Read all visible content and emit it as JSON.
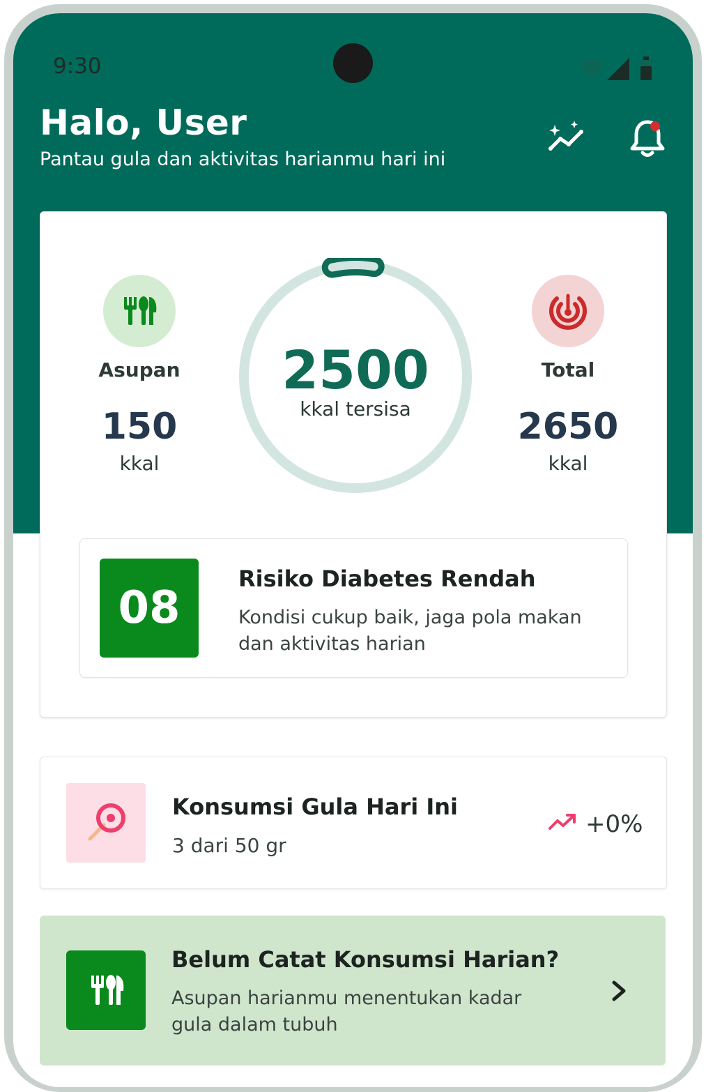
{
  "status_bar": {
    "time": "9:30"
  },
  "header": {
    "greeting": "Halo, User",
    "subtitle": "Pantau gula dan aktivitas harianmu hari ini",
    "icons": [
      "insights-icon",
      "notification-bell-icon"
    ]
  },
  "calorie_summary": {
    "intake": {
      "label": "Asupan",
      "value": "150",
      "unit": "kkal",
      "icon": "utensils-icon"
    },
    "remaining": {
      "value": "2500",
      "caption": "kkal tersisa",
      "progress_fraction": 0.06
    },
    "total": {
      "label": "Total",
      "value": "2650",
      "unit": "kkal",
      "icon": "target-icon"
    }
  },
  "risk": {
    "score": "08",
    "title": "Risiko Diabetes Rendah",
    "description": "Kondisi cukup baik, jaga pola makan dan aktivitas harian"
  },
  "sugar": {
    "title": "Konsumsi Gula Hari Ini",
    "subtitle": "3 dari 50 gr",
    "trend": "+0%",
    "icon": "lollipop-icon"
  },
  "log_prompt": {
    "title": "Belum Catat Konsumsi Harian?",
    "description": "Asupan harianmu menentukan kadar gula dalam tubuh",
    "icon": "utensils-icon"
  },
  "colors": {
    "primary": "#006b5b",
    "accent_green": "#0a8a1c",
    "ring_track": "#d3e5e1",
    "intake_bg": "#d4ecd1",
    "total_bg": "#f3d3d3",
    "total_icon": "#cc2a2a",
    "sugar_icon": "#ee3e6d",
    "log_card_bg": "#cfe6cc"
  }
}
